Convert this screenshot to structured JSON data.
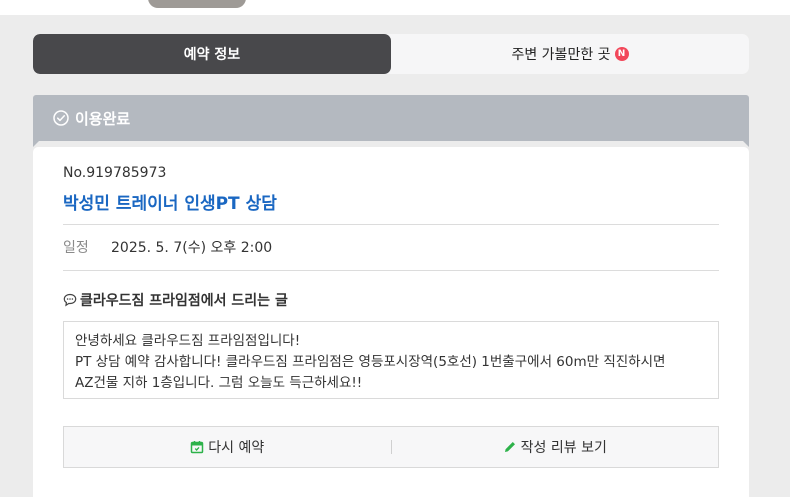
{
  "tabs": [
    {
      "label": "예약 정보",
      "active": true
    },
    {
      "label": "주변 가볼만한 곳",
      "active": false,
      "badge": "N"
    }
  ],
  "status": {
    "label": "이용완료",
    "icon": "check-circle-icon"
  },
  "booking": {
    "order_no": "No.919785973",
    "title": "박성민 트레이너 인생PT 상담",
    "schedule_label": "일정",
    "schedule_value": "2025. 5. 7(수) 오후 2:00"
  },
  "message": {
    "title": "클라우드짐 프라임점에서 드리는 글",
    "icon": "speech-bubble-icon",
    "lines": [
      "안녕하세요 클라우드짐 프라임점입니다!",
      "PT 상담 예약 감사합니다! 클라우드짐 프라임점은 영등포시장역(5호선) 1번출구에서 60m만 직진하시면",
      "AZ건물 지하 1층입니다. 그럼 오늘도 득근하세요!!"
    ]
  },
  "actions": {
    "rebook": {
      "label": "다시 예약",
      "icon": "calendar-icon"
    },
    "review": {
      "label": "작성 리뷰 보기",
      "icon": "pencil-icon"
    }
  },
  "colors": {
    "accent_blue": "#1a67c2",
    "status_bar": "#b4b9c0",
    "active_tab": "#48484b",
    "badge_red": "#f2475a",
    "calendar_green": "#2db24a"
  }
}
